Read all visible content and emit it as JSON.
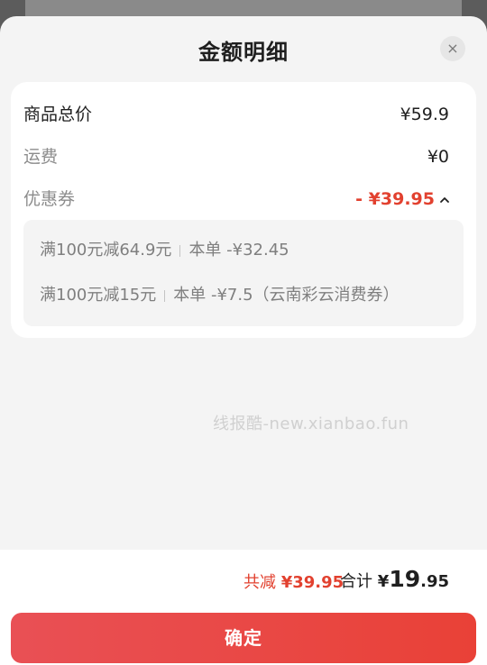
{
  "sheet": {
    "title": "金额明细",
    "close_icon": "×"
  },
  "summary_rows": {
    "total_label": "商品总价",
    "total_value": "¥59.9",
    "shipping_label": "运费",
    "shipping_value": "¥0",
    "coupon_label": "优惠券",
    "coupon_value": "- ¥39.95"
  },
  "coupons": [
    {
      "rule": "满100元减64.9元",
      "detail": "本单 -¥32.45"
    },
    {
      "rule": "满100元减15元",
      "detail": "本单 -¥7.5（云南彩云消费券）"
    }
  ],
  "watermark": "线报酷-new.xianbao.fun",
  "footer": {
    "reduce_label": "共减",
    "reduce_amount": "¥39.95",
    "total_label": "合计",
    "total_yen": "¥",
    "total_int": "19",
    "total_dec": ".95",
    "confirm_label": "确定"
  },
  "colors": {
    "accent": "#e2412f",
    "button_start": "#e95055",
    "button_end": "#e94137"
  }
}
